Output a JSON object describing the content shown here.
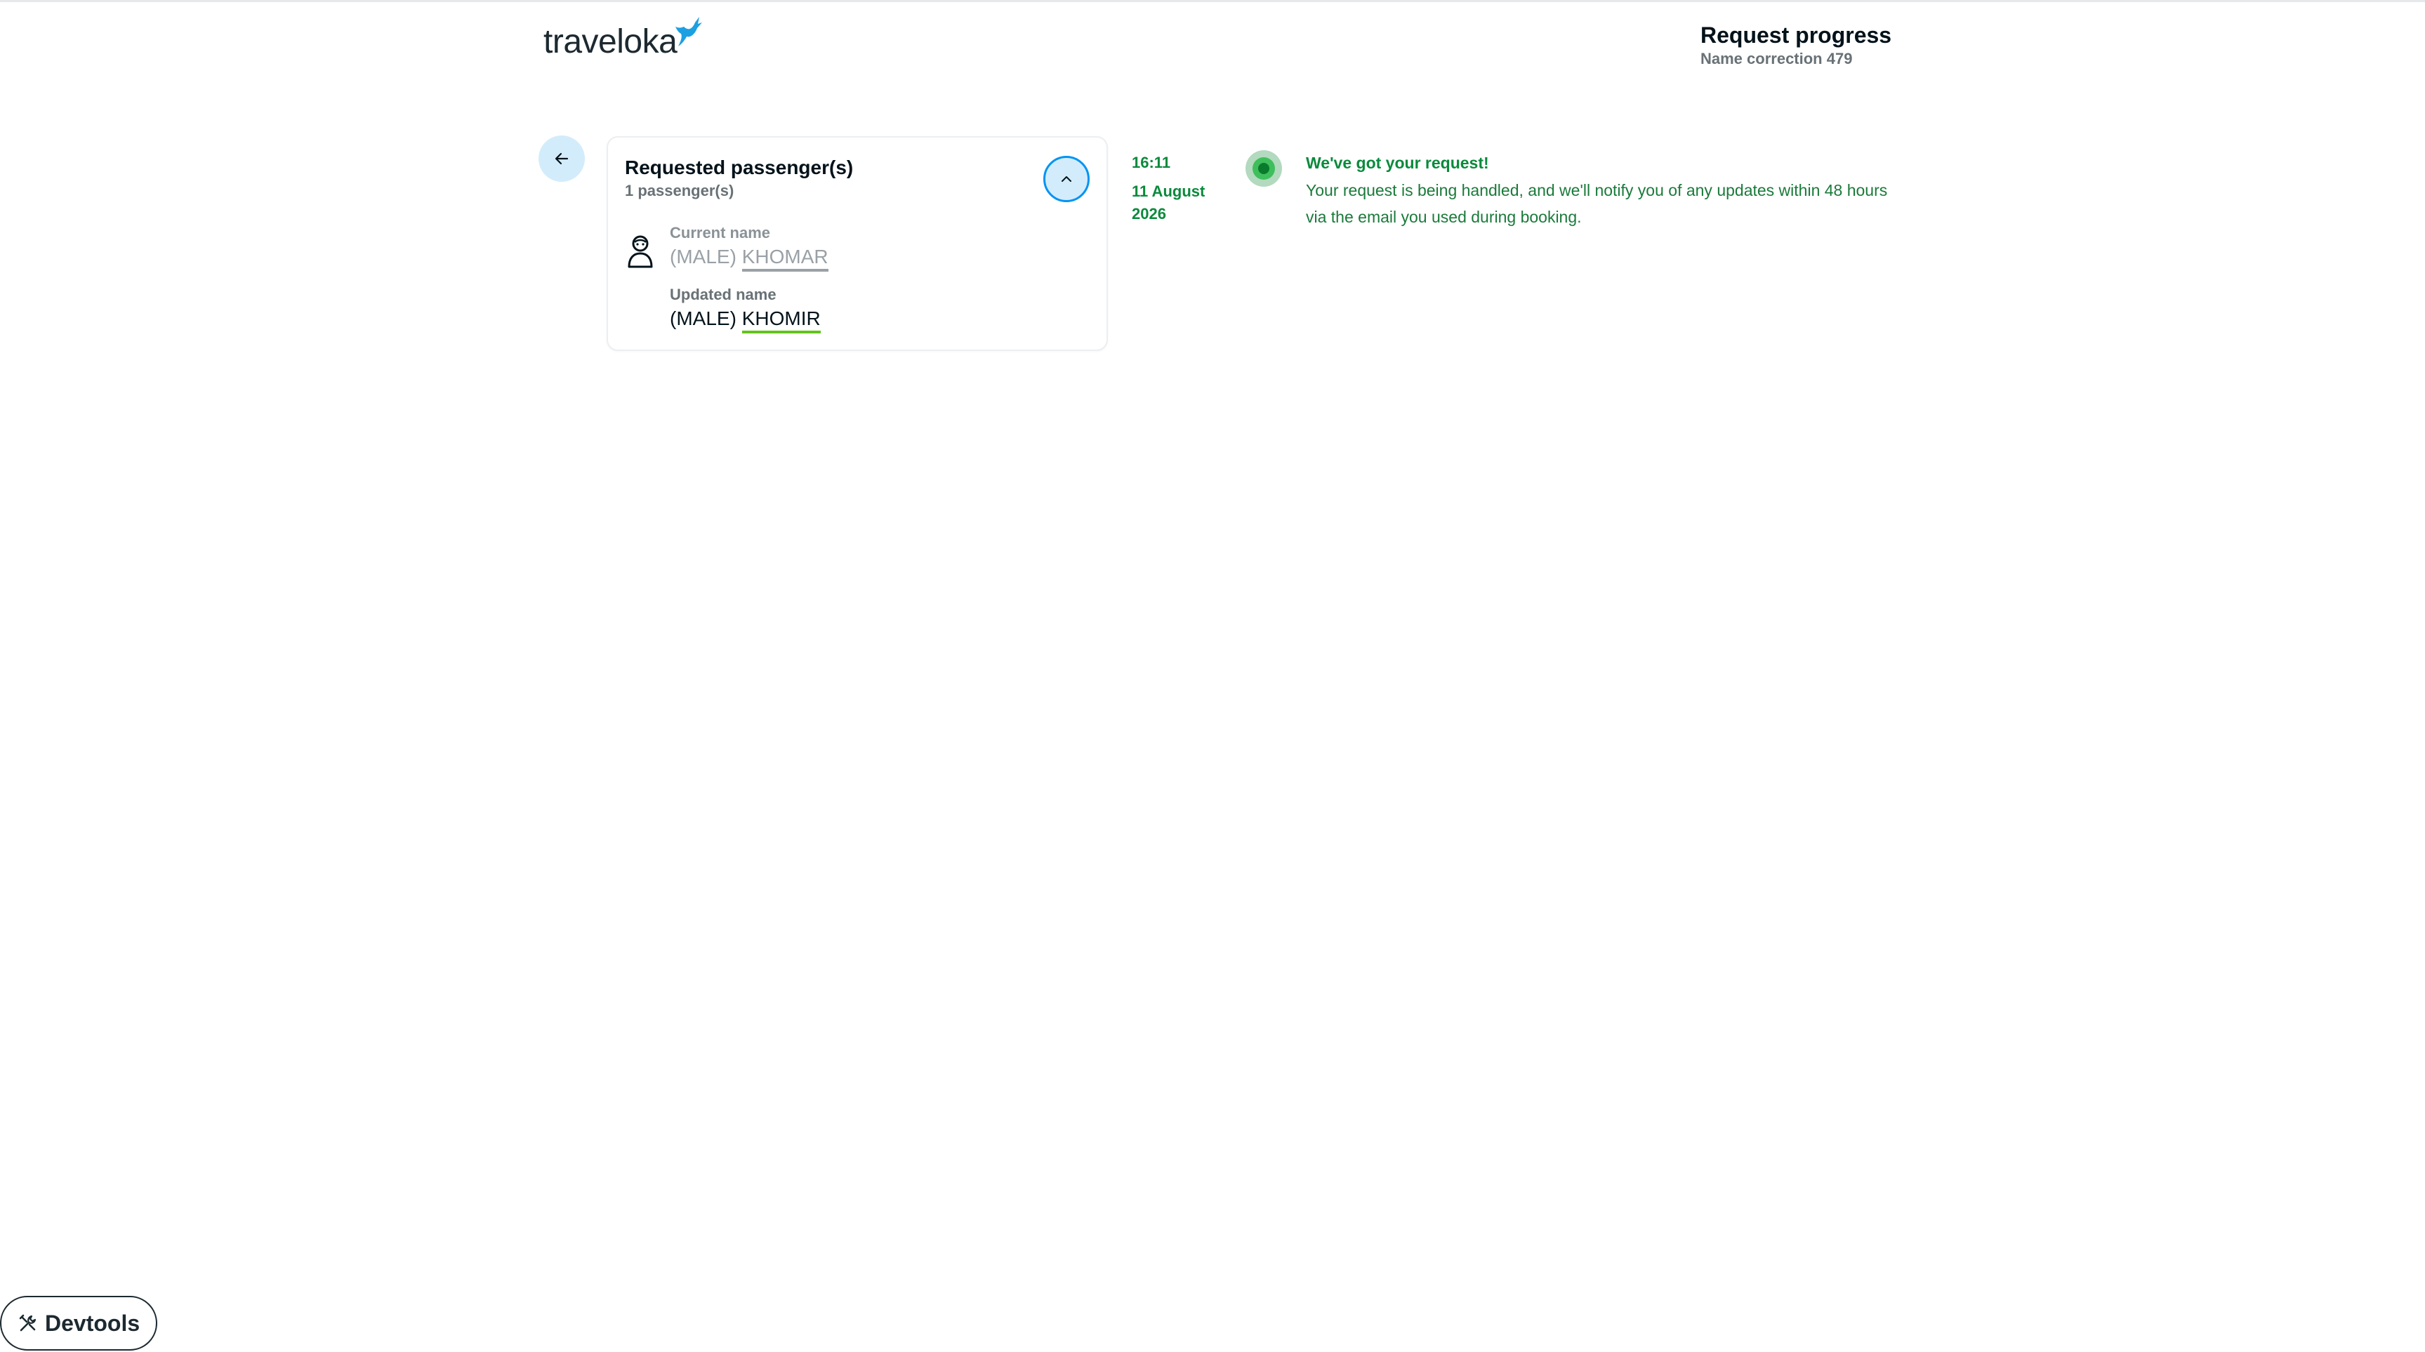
{
  "header": {
    "logo_text": "traveloka",
    "title": "Request progress",
    "subtitle": "Name correction 479"
  },
  "passenger_card": {
    "title": "Requested passenger(s)",
    "count": "1 passenger(s)",
    "current_label": "Current name",
    "current_prefix": "(MALE)",
    "current_surname": "KHOMAR",
    "updated_label": "Updated name",
    "updated_prefix": "(MALE)",
    "updated_surname": "KHOMIR"
  },
  "timeline": {
    "time": "16:11",
    "date": "11 August 2026",
    "title": "We've got your request!",
    "description": "Your request is being handled, and we'll notify you of any updates within 48 hours via the email you used during booking."
  },
  "devtools": {
    "label": "Devtools"
  },
  "icons": {
    "back": "arrow-left-icon",
    "collapse": "chevron-up-icon",
    "passenger": "person-icon",
    "status": "status-dot-icon",
    "devtools": "tools-icon",
    "logo": "bird-logo-icon"
  },
  "colors": {
    "accent_blue": "#0194f3",
    "light_blue": "#d3ecfb",
    "success_green": "#0a8a3c",
    "highlight_green": "#62c51a"
  }
}
